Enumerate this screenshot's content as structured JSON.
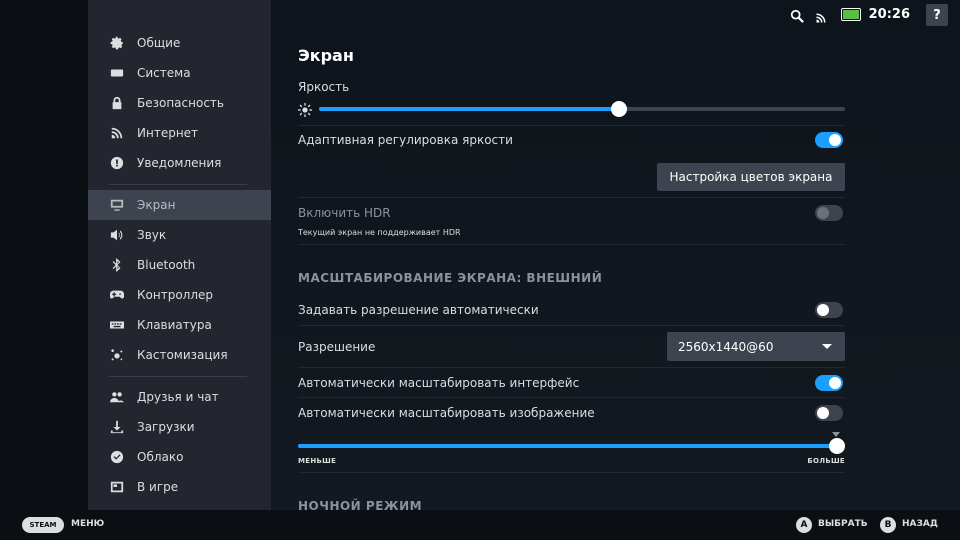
{
  "sidebar": {
    "items": [
      {
        "label": "Общие",
        "icon": "gear-icon"
      },
      {
        "label": "Система",
        "icon": "keyboard-icon"
      },
      {
        "label": "Безопасность",
        "icon": "lock-icon"
      },
      {
        "label": "Интернет",
        "icon": "wifi-icon"
      },
      {
        "label": "Уведомления",
        "icon": "alert-icon"
      },
      {
        "label": "Экран",
        "icon": "monitor-icon",
        "active": true
      },
      {
        "label": "Звук",
        "icon": "speaker-icon"
      },
      {
        "label": "Bluetooth",
        "icon": "bluetooth-icon"
      },
      {
        "label": "Контроллер",
        "icon": "gamepad-icon"
      },
      {
        "label": "Клавиатура",
        "icon": "keyboard-icon"
      },
      {
        "label": "Кастомизация",
        "icon": "sparkle-icon"
      },
      {
        "label": "Друзья и чат",
        "icon": "friends-icon"
      },
      {
        "label": "Загрузки",
        "icon": "download-icon"
      },
      {
        "label": "Облако",
        "icon": "cloud-icon"
      },
      {
        "label": "В игре",
        "icon": "ingame-icon"
      }
    ]
  },
  "topbar": {
    "time": "20:26",
    "help": "?",
    "icons": [
      "search-icon",
      "wifi-icon",
      "battery-icon"
    ]
  },
  "main": {
    "title": "Экран",
    "brightness": {
      "label": "Яркость",
      "value": 0.57
    },
    "adaptive_brightness": {
      "label": "Адаптивная регулировка яркости",
      "on": true
    },
    "color_button": "Настройка цветов экрана",
    "hdr": {
      "label": "Включить HDR",
      "sublabel": "Текущий экран не поддерживает HDR",
      "on": false,
      "disabled": true
    },
    "scaling_section": "МАСШТАБИРОВАНИЕ ЭКРАНА: ВНЕШНИЙ",
    "auto_resolution": {
      "label": "Задавать разрешение автоматически",
      "on": false
    },
    "resolution": {
      "label": "Разрешение",
      "value": "2560x1440@60"
    },
    "auto_scale_ui": {
      "label": "Автоматически масштабировать интерфейс",
      "on": true
    },
    "auto_scale_image": {
      "label": "Автоматически масштабировать изображение",
      "on": false
    },
    "scale_slider": {
      "min_label": "МЕНЬШЕ",
      "max_label": "БОЛЬШЕ",
      "value": 1.0
    },
    "night_section": "НОЧНОЙ РЕЖИМ"
  },
  "bottombar": {
    "steam": "STEAM",
    "menu": "МЕНЮ",
    "a_key": "A",
    "a_label": "ВЫБРАТЬ",
    "b_key": "B",
    "b_label": "НАЗАД"
  },
  "colors": {
    "accent": "#1a9fff",
    "sidebar_bg": "#23262e",
    "active_bg": "#3d4450"
  }
}
